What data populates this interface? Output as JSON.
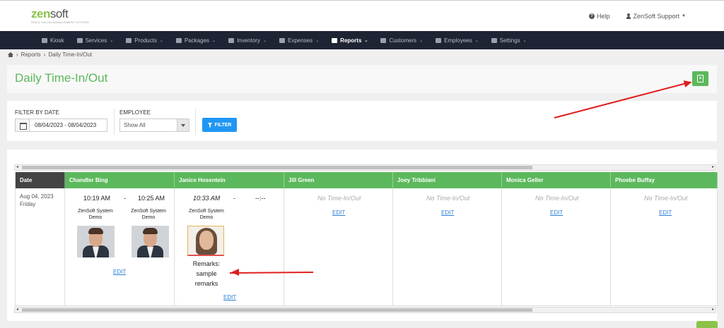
{
  "brand": {
    "name_a": "zen",
    "name_b": "soft",
    "tagline": "SPA & SALON MANAGEMENT SYSTEM"
  },
  "top_right": {
    "help": "Help",
    "user": "ZenSoft Support"
  },
  "nav": [
    {
      "label": "Kiosk",
      "caret": false,
      "active": false
    },
    {
      "label": "Services",
      "caret": true,
      "active": false
    },
    {
      "label": "Products",
      "caret": true,
      "active": false
    },
    {
      "label": "Packages",
      "caret": true,
      "active": false
    },
    {
      "label": "Inventory",
      "caret": true,
      "active": false
    },
    {
      "label": "Expenses",
      "caret": true,
      "active": false
    },
    {
      "label": "Reports",
      "caret": true,
      "active": true
    },
    {
      "label": "Customers",
      "caret": true,
      "active": false
    },
    {
      "label": "Employees",
      "caret": true,
      "active": false
    },
    {
      "label": "Settings",
      "caret": true,
      "active": false
    }
  ],
  "breadcrumb": {
    "reports": "Reports",
    "current": "Daily Time-In/Out"
  },
  "page": {
    "title": "Daily Time-In/Out"
  },
  "filters": {
    "date_label": "FILTER BY DATE",
    "date_value": "08/04/2023 - 08/04/2023",
    "employee_label": "EMPLOYEE",
    "employee_value": "Show All",
    "filter_button": "FILTER"
  },
  "table": {
    "date_header": "Date",
    "employees": [
      "Chandler Bing",
      "Janice Hosentein",
      "Jill Green",
      "Joey Tribbiani",
      "Monica Geller",
      "Phoebe Buffay"
    ],
    "row": {
      "date": "Aug 04, 2023",
      "day": "Friday",
      "chandler": {
        "time_in": "10:19 AM",
        "time_out": "10:25 AM",
        "in_device": "ZenSoft System Demo",
        "out_device": "ZenSoft System Demo",
        "edit": "EDIT"
      },
      "janice": {
        "time_in": "10:33 AM",
        "time_out": "--:--",
        "in_device": "ZenSoft System Demo",
        "remarks": [
          "Remarks:",
          "sample",
          "remarks"
        ],
        "edit": "EDIT"
      },
      "no_time_text": "No Time-In/Out",
      "edit": "EDIT"
    },
    "dash": "-"
  },
  "colors": {
    "accent_green": "#5cb85c",
    "nav_bg": "#1f2434",
    "filter_blue": "#2196f3",
    "annotation_red": "#e01e1e"
  },
  "icons": [
    "help-circle-icon",
    "user-icon",
    "home-icon",
    "calendar-icon",
    "funnel-icon",
    "excel-export-icon"
  ]
}
